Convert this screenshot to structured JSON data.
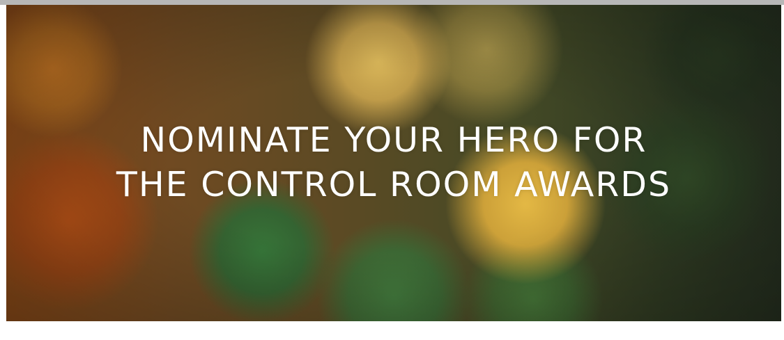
{
  "banner": {
    "headline_line1": "NOMINATE YOUR HERO FOR",
    "headline_line2": "THE CONTROL ROOM AWARDS",
    "text_color": "#ffffff",
    "background_style": "bokeh",
    "palette": [
      "#8a4a18",
      "#e0bc5c",
      "#ecbe46",
      "#34783a",
      "#263020"
    ]
  }
}
